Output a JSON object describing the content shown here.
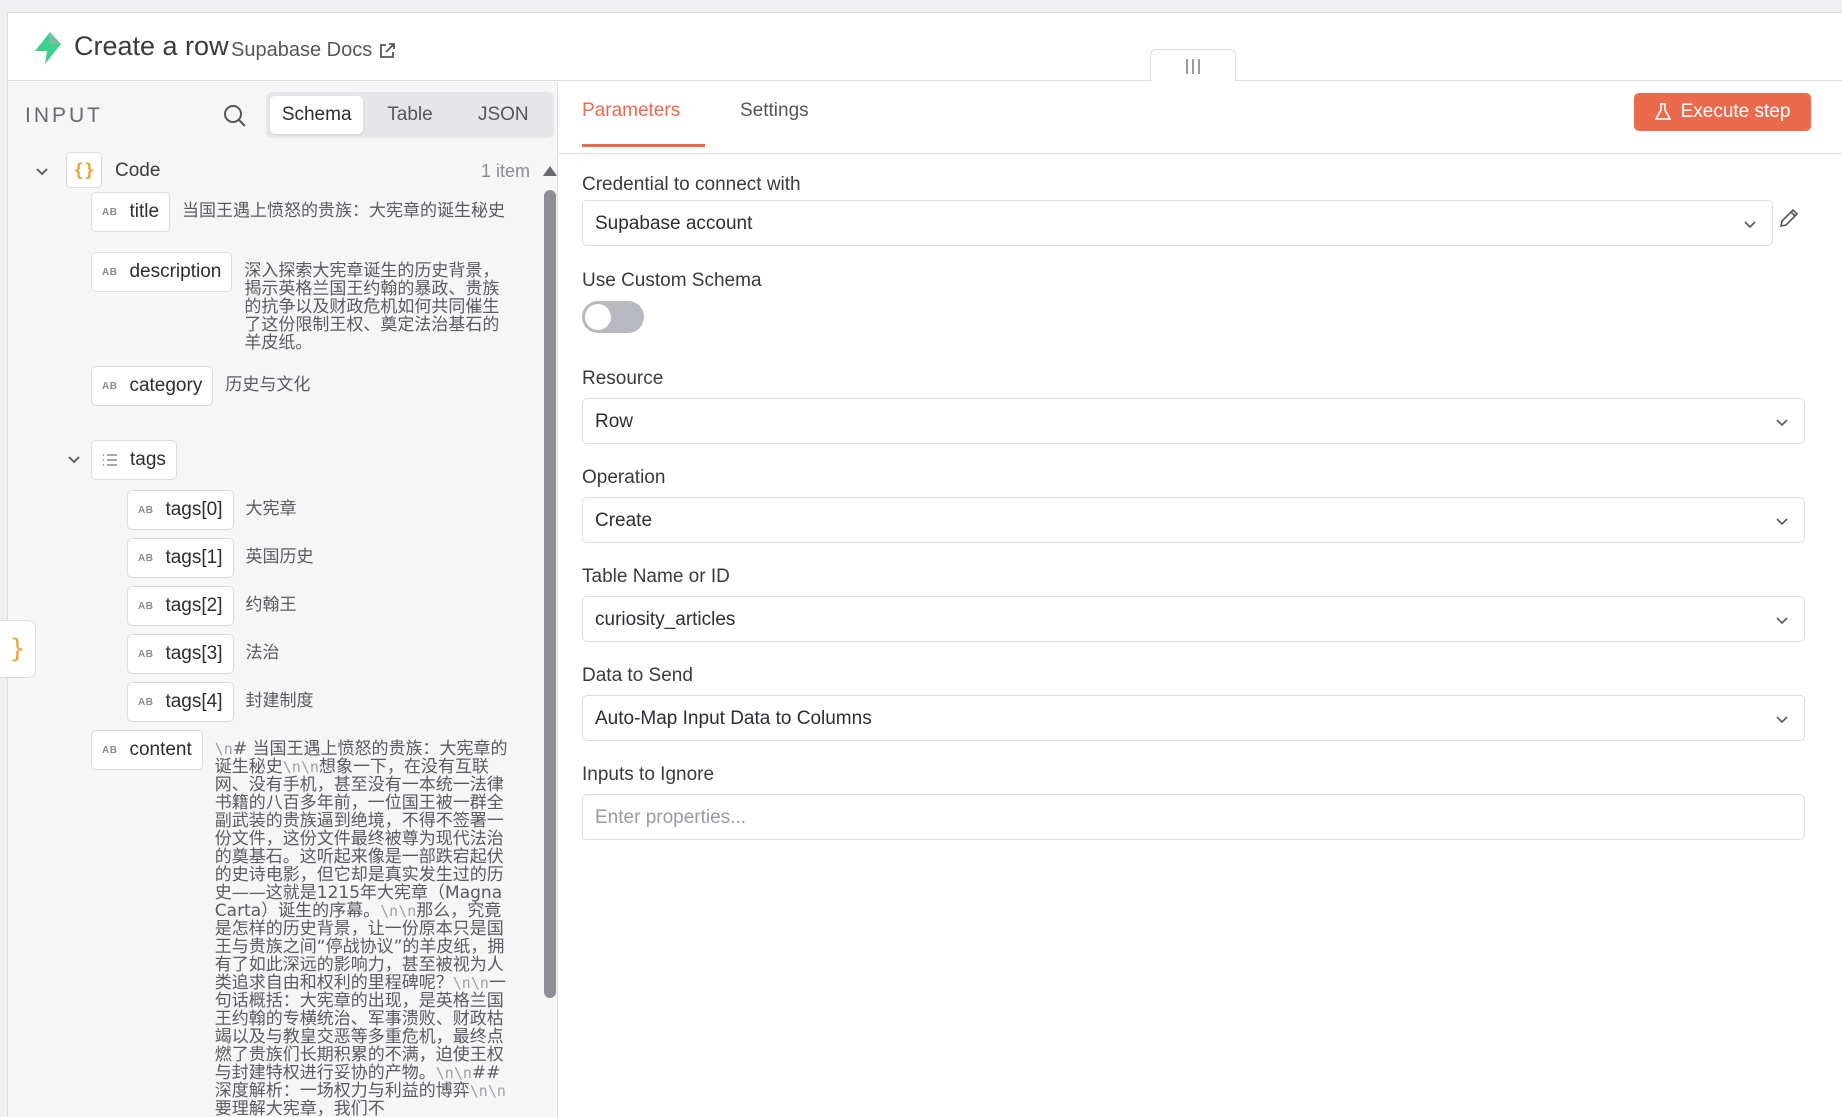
{
  "header": {
    "title": "Create a row",
    "docs_label": "Supabase Docs"
  },
  "input_panel": {
    "label": "INPUT",
    "tabs": [
      "Schema",
      "Table",
      "JSON"
    ],
    "active_tab": "Schema",
    "node_name": "Code",
    "item_count": "1 item",
    "type_badge": "AB",
    "fields": {
      "title": {
        "key": "title",
        "value": "当国王遇上愤怒的贵族：大宪章的诞生秘史"
      },
      "description": {
        "key": "description",
        "value": "深入探索大宪章诞生的历史背景，揭示英格兰国王约翰的暴政、贵族的抗争以及财政危机如何共同催生了这份限制王权、奠定法治基石的羊皮纸。"
      },
      "category": {
        "key": "category",
        "value": "历史与文化"
      },
      "tags": {
        "key": "tags"
      },
      "tag0": {
        "key": "tags[0]",
        "value": "大宪章"
      },
      "tag1": {
        "key": "tags[1]",
        "value": "英国历史"
      },
      "tag2": {
        "key": "tags[2]",
        "value": "约翰王"
      },
      "tag3": {
        "key": "tags[3]",
        "value": "法治"
      },
      "tag4": {
        "key": "tags[4]",
        "value": "封建制度"
      },
      "content": {
        "key": "content",
        "esc": "\\n",
        "p1": "# 当国王遇上愤怒的贵族：大宪章的诞生秘史",
        "p2": "想象一下，在没有互联网、没有手机，甚至没有一本统一法律书籍的八百多年前，一位国王被一群全副武装的贵族逼到绝境，不得不签署一份文件，这份文件最终被尊为现代法治的奠基石。这听起来像是一部跌宕起伏的史诗电影，但它却是真实发生过的历史——这就是1215年大宪章（Magna Carta）诞生的序幕。",
        "p3": "那么，究竟是怎样的历史背景，让一份原本只是国王与贵族之间“停战协议”的羊皮纸，拥有了如此深远的影响力，甚至被视为人类追求自由和权利的里程碑呢？",
        "p4": "一句话概括：大宪章的出现，是英格兰国王约翰的专横统治、军事溃败、财政枯竭以及与教皇交恶等多重危机，最终点燃了贵族们长期积累的不满，迫使王权与封建特权进行妥协的产物。",
        "p5": "## 深度解析：一场权力与利益的博弈",
        "p6": "要理解大宪章，我们不"
      }
    }
  },
  "params_panel": {
    "tabs": [
      "Parameters",
      "Settings"
    ],
    "active_tab": "Parameters",
    "execute_label": "Execute step",
    "credential": {
      "label": "Credential to connect with",
      "value": "Supabase account"
    },
    "custom_schema": {
      "label": "Use Custom Schema",
      "enabled": false
    },
    "resource": {
      "label": "Resource",
      "value": "Row"
    },
    "operation": {
      "label": "Operation",
      "value": "Create"
    },
    "table": {
      "label": "Table Name or ID",
      "value": "curiosity_articles"
    },
    "data_to_send": {
      "label": "Data to Send",
      "value": "Auto-Map Input Data to Columns"
    },
    "inputs_to_ignore": {
      "label": "Inputs to Ignore",
      "placeholder": "Enter properties..."
    }
  },
  "colors": {
    "accent": "#ea6a4e",
    "json_icon": "#f0a33b",
    "node_icon": "#3ecf8e"
  }
}
